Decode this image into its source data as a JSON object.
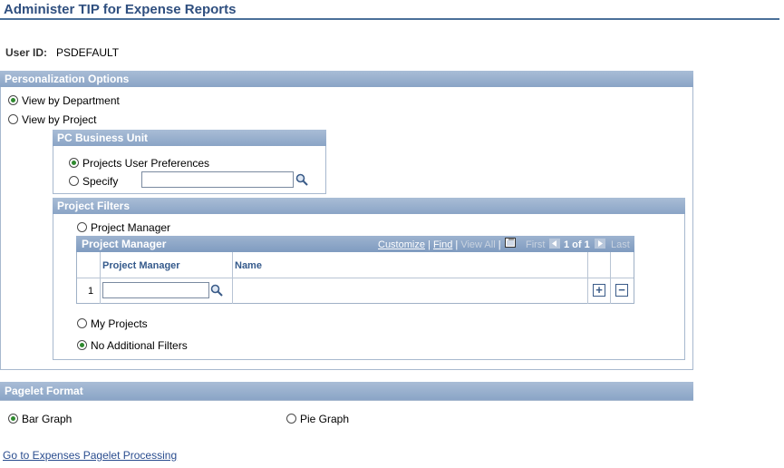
{
  "page": {
    "title": "Administer TIP for Expense Reports"
  },
  "user": {
    "label": "User ID:",
    "value": "PSDEFAULT"
  },
  "personalization": {
    "header": "Personalization Options",
    "view_by_department": "View by Department",
    "view_by_project": "View by Project",
    "selected": "View by Department"
  },
  "pc_business_unit": {
    "header": "PC Business Unit",
    "projects_user_prefs": "Projects User Preferences",
    "specify": "Specify",
    "specify_value": "",
    "selected": "Projects User Preferences"
  },
  "project_filters": {
    "header": "Project Filters",
    "project_manager": "Project Manager",
    "my_projects": "My Projects",
    "no_additional_filters": "No Additional Filters",
    "selected": "No Additional Filters"
  },
  "pm_grid": {
    "title": "Project Manager",
    "customize": "Customize",
    "find": "Find",
    "view_all": "View All",
    "first": "First",
    "range": "1 of 1",
    "last": "Last",
    "col_manager": "Project Manager",
    "col_name": "Name",
    "rows": [
      {
        "num": "1",
        "manager": "",
        "name": ""
      }
    ],
    "add_label": "+",
    "delete_label": "−"
  },
  "pagelet_format": {
    "header": "Pagelet Format",
    "bar_graph": "Bar Graph",
    "pie_graph": "Pie Graph",
    "selected": "Bar Graph"
  },
  "footer": {
    "link": "Go to Expenses Pagelet Processing"
  },
  "colors": {
    "accent": "#2f4f7f",
    "section_header": "#8aa4c6",
    "radio_on": "#2f8a2f"
  }
}
